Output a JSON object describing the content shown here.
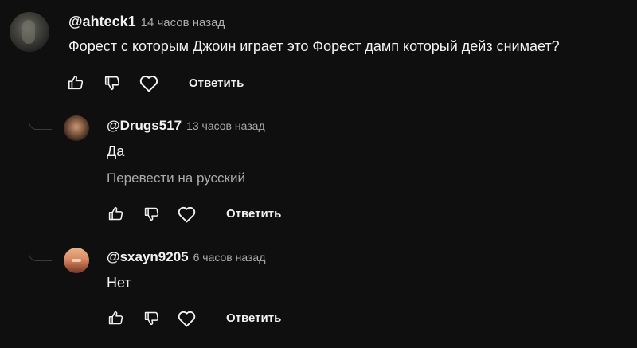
{
  "comments": [
    {
      "author": "@ahteck1",
      "time": "14 часов назад",
      "text": "Форест с которым Джоин играет это Форест дамп который дейз снимает?",
      "reply_label": "Ответить"
    },
    {
      "author": "@Drugs517",
      "time": "13 часов назад",
      "text": "Да",
      "translate_label": "Перевести на русский",
      "reply_label": "Ответить"
    },
    {
      "author": "@sxayn9205",
      "time": "6 часов назад",
      "text": "Нет",
      "reply_label": "Ответить"
    }
  ],
  "icons": {
    "like": "thumbs-up-icon",
    "dislike": "thumbs-down-icon",
    "heart": "heart-icon"
  },
  "colors": {
    "background": "#0f0f0f",
    "text": "#f1f1f1",
    "muted": "#aaaaaa",
    "thread_line": "#3a3a3a"
  }
}
